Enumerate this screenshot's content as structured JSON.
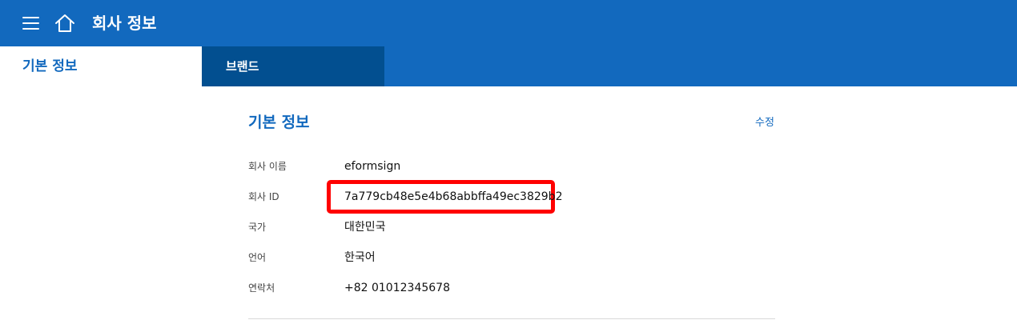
{
  "header": {
    "title": "회사 정보",
    "menu_icon": "hamburger-menu-icon",
    "home_icon": "home-icon"
  },
  "tabs": [
    {
      "label": "기본 정보",
      "active": true
    },
    {
      "label": "브랜드",
      "active": false
    }
  ],
  "section": {
    "title": "기본 정보",
    "edit_label": "수정"
  },
  "fields": [
    {
      "label": "회사 이름",
      "value": "eformsign"
    },
    {
      "label": "회사 ID",
      "value": "7a779cb48e5e4b68abbffa49ec3829b2"
    },
    {
      "label": "국가",
      "value": "대한민국"
    },
    {
      "label": "언어",
      "value": "한국어"
    },
    {
      "label": "연락처",
      "value": "+82 01012345678"
    }
  ],
  "colors": {
    "header_bg": "#1269be",
    "active_tab_text": "#1269be",
    "inactive_tab_bg": "#024f90",
    "highlight": "#ff0000"
  }
}
